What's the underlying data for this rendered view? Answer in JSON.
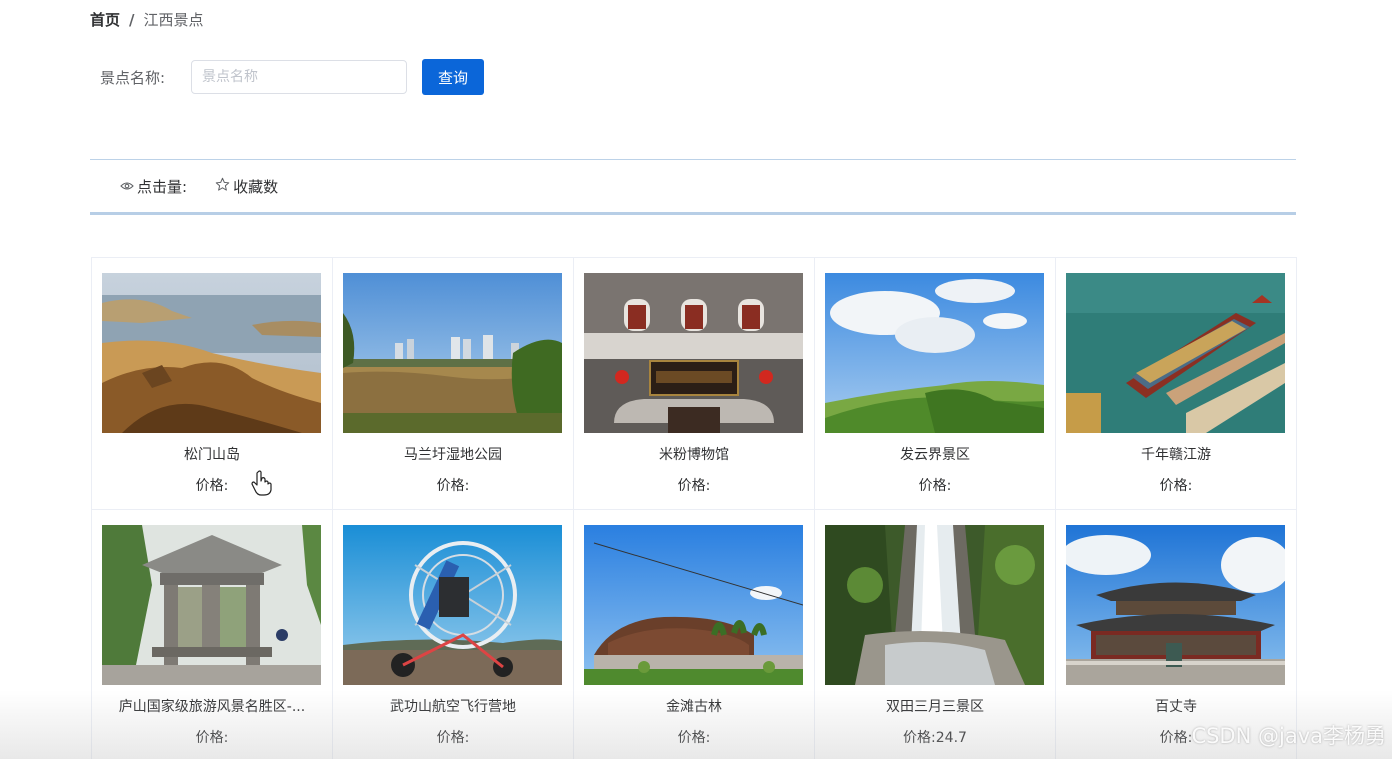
{
  "breadcrumb": {
    "home": "首页",
    "separator": "/",
    "current": "江西景点"
  },
  "search": {
    "label": "景点名称:",
    "placeholder": "景点名称",
    "value": "",
    "button_label": "查询"
  },
  "sort": {
    "clicks_label": "点击量:",
    "clicks_icon": "eye-icon",
    "favorites_label": "收藏数",
    "favorites_icon": "star-icon"
  },
  "spots": [
    {
      "name": "松门山岛",
      "price": "价格:",
      "image": "coastal-rock-lake-photo"
    },
    {
      "name": "马兰圩湿地公园",
      "price": "价格:",
      "image": "wetland-city-skyline-photo"
    },
    {
      "name": "米粉博物馆",
      "price": "价格:",
      "image": "museum-facade-photo"
    },
    {
      "name": "发云界景区",
      "price": "价格:",
      "image": "green-hills-sky-photo"
    },
    {
      "name": "千年赣江游",
      "price": "价格:",
      "image": "river-cruise-boat-photo"
    },
    {
      "name": "庐山国家级旅游风景名胜区-...",
      "price": "价格:",
      "image": "stone-pavilion-photo"
    },
    {
      "name": "武功山航空飞行营地",
      "price": "价格:",
      "image": "paramotor-aircraft-photo"
    },
    {
      "name": "金滩古林",
      "price": "价格:",
      "image": "ancient-forest-sign-photo"
    },
    {
      "name": "双田三月三景区",
      "price": "价格:24.7",
      "image": "waterfall-photo"
    },
    {
      "name": "百丈寺",
      "price": "价格:",
      "image": "temple-hall-photo"
    }
  ],
  "watermark": "CSDN @java李杨勇",
  "colors": {
    "primary": "#0b66d9",
    "divider": "#b7cee6",
    "text": "#303133",
    "muted": "#606266"
  }
}
